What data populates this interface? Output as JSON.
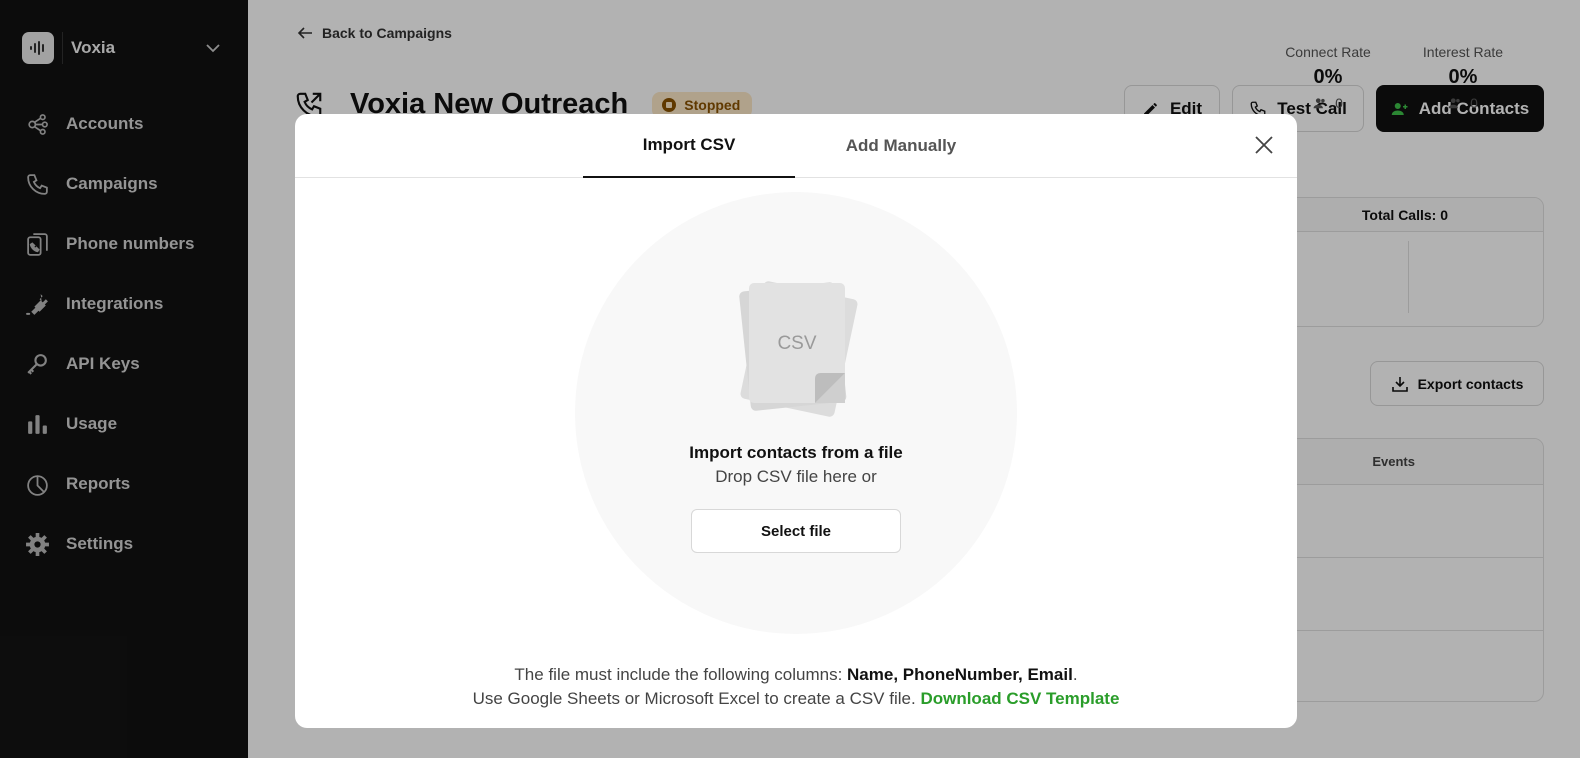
{
  "sidebar": {
    "workspace_name": "Voxia",
    "items": [
      {
        "label": "Accounts",
        "icon": "accounts-icon"
      },
      {
        "label": "Campaigns",
        "icon": "phone-icon"
      },
      {
        "label": "Phone numbers",
        "icon": "phone-numbers-icon"
      },
      {
        "label": "Integrations",
        "icon": "plug-icon"
      },
      {
        "label": "API Keys",
        "icon": "key-icon"
      },
      {
        "label": "Usage",
        "icon": "bar-chart-icon"
      },
      {
        "label": "Reports",
        "icon": "pie-chart-icon"
      },
      {
        "label": "Settings",
        "icon": "gear-icon"
      }
    ]
  },
  "page": {
    "back_label": "Back to Campaigns",
    "title": "Voxia New Outreach",
    "status": "Stopped",
    "edit_label": "Edit",
    "test_call_label": "Test Call",
    "add_contacts_label": "Add Contacts",
    "export_label": "Export contacts"
  },
  "stats": {
    "total_calls": "Total Calls: 0",
    "connect_rate_label": "Connect Rate",
    "connect_rate_value": "0%",
    "connect_rate_count": "0",
    "interest_rate_label": "Interest Rate",
    "interest_rate_value": "0%",
    "interest_rate_count": "0"
  },
  "table": {
    "events_header": "Events"
  },
  "modal": {
    "tab_import": "Import CSV",
    "tab_manual": "Add Manually",
    "csv_label": "CSV",
    "drop_title": "Import contacts from a file",
    "drop_subtitle": "Drop CSV file here or",
    "select_file_label": "Select file",
    "columns_prefix": "The file must include the following columns: ",
    "columns_required": "Name, PhoneNumber, Email",
    "columns_suffix": ".",
    "template_prefix": "Use Google Sheets or Microsoft Excel to create a CSV file. ",
    "template_link": "Download CSV Template"
  },
  "colors": {
    "sidebar_bg": "#121212",
    "status_bg": "#fde9c8",
    "status_fg": "#8a5200",
    "link_green": "#2a9d2a"
  }
}
